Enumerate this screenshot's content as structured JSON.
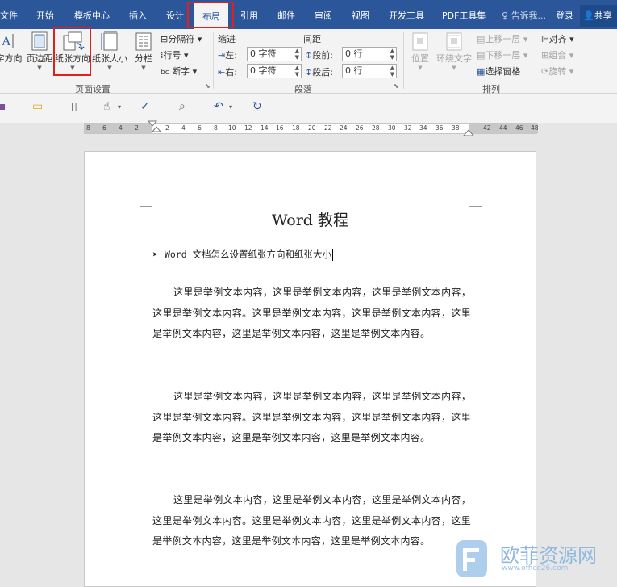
{
  "menubar": {
    "tabs": [
      "文件",
      "开始",
      "模板中心",
      "插入",
      "设计",
      "布局",
      "引用",
      "邮件",
      "审阅",
      "视图",
      "开发工具",
      "PDF工具集"
    ],
    "active_tab": "布局",
    "tell_me": "告诉我...",
    "login": "登录",
    "share": "共享"
  },
  "ribbon": {
    "text_direction": "字方向",
    "margins": "页边距",
    "orientation": "纸张方向",
    "size": "纸张大小",
    "columns": "分栏",
    "breaks": "分隔符",
    "line_numbers": "行号",
    "hyphenation": "断字",
    "page_setup_label": "页面设置",
    "indent_label": "缩进",
    "spacing_label": "间距",
    "indent_left": "左:",
    "indent_right": "右:",
    "spacing_before": "段前:",
    "spacing_after": "段后:",
    "indent_left_value": "0 字符",
    "indent_right_value": "0 字符",
    "spacing_before_value": "0 行",
    "spacing_after_value": "0 行",
    "paragraph_label": "段落",
    "position": "位置",
    "wrap_text": "环绕文字",
    "bring_forward": "上移一层",
    "send_backward": "下移一层",
    "selection_pane": "选择窗格",
    "align": "对齐",
    "group": "组合",
    "rotate": "旋转",
    "arrange_label": "排列"
  },
  "ruler": {
    "left_numbers": [
      "8",
      "6",
      "4",
      "2"
    ],
    "numbers": [
      "2",
      "4",
      "6",
      "8",
      "10",
      "12",
      "14",
      "16",
      "18",
      "20",
      "22",
      "24",
      "26",
      "28",
      "30",
      "32",
      "34",
      "36",
      "38"
    ],
    "right_numbers": [
      "42",
      "44",
      "46",
      "48"
    ]
  },
  "document": {
    "title": "Word 教程",
    "bullet_text": "Word 文档怎么设置纸张方向和纸张大小",
    "paragraphs": [
      "这里是举例文本内容，这里是举例文本内容，这里是举例文本内容，这里是举例文本内容。这里是举例文本内容，这里是举例文本内容，这里是举例文本内容，这里是举例文本内容，这里是举例文本内容。",
      "这里是举例文本内容，这里是举例文本内容，这里是举例文本内容，这里是举例文本内容。这里是举例文本内容，这里是举例文本内容，这里是举例文本内容，这里是举例文本内容，这里是举例文本内容。",
      "这里是举例文本内容，这里是举例文本内容，这里是举例文本内容，这里是举例文本内容。这里是举例文本内容，这里是举例文本内容，这里是举例文本内容，这里是举例文本内容，这里是举例文本内容。"
    ]
  },
  "watermark": {
    "name": "欧菲资源网",
    "url": "www.office26.com"
  },
  "colors": {
    "brand": "#2b579a",
    "highlight": "#e0201f"
  }
}
